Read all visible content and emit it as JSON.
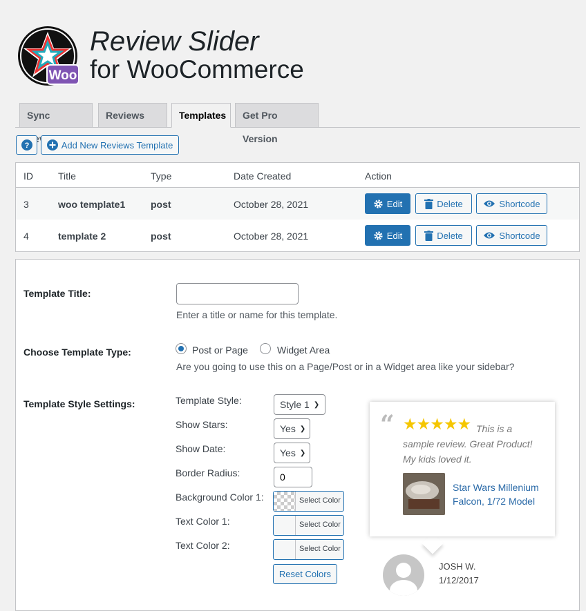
{
  "header": {
    "title_line1": "Review Slider",
    "title_line2": "for WooCommerce",
    "logo_badge": "Woo"
  },
  "tabs": [
    {
      "label": "Sync Reviews",
      "active": false
    },
    {
      "label": "Reviews List",
      "active": false
    },
    {
      "label": "Templates",
      "active": true
    },
    {
      "label": "Get Pro Version",
      "active": false
    }
  ],
  "toolbar": {
    "help_label": "?",
    "add_label": "Add New Reviews Template"
  },
  "table": {
    "headers": [
      "ID",
      "Title",
      "Type",
      "Date Created",
      "Action"
    ],
    "rows": [
      {
        "id": "3",
        "title": "woo template1",
        "type": "post",
        "date": "October 28, 2021"
      },
      {
        "id": "4",
        "title": "template 2",
        "type": "post",
        "date": "October 28, 2021"
      }
    ],
    "actions": {
      "edit": "Edit",
      "delete": "Delete",
      "shortcode": "Shortcode"
    }
  },
  "form": {
    "title_label": "Template Title:",
    "title_value": "",
    "title_hint": "Enter a title or name for this template.",
    "type_label": "Choose Template Type:",
    "type_options": [
      "Post or Page",
      "Widget Area"
    ],
    "type_selected": "Post or Page",
    "type_hint": "Are you going to use this on a Page/Post or in a Widget area like your sidebar?",
    "style_label": "Template Style Settings:",
    "fields": {
      "template_style": {
        "label": "Template Style:",
        "value": "Style 1"
      },
      "show_stars": {
        "label": "Show Stars:",
        "value": "Yes"
      },
      "show_date": {
        "label": "Show Date:",
        "value": "Yes"
      },
      "border_radius": {
        "label": "Border Radius:",
        "value": "0"
      },
      "bg_color": {
        "label": "Background Color 1:",
        "button": "Select Color"
      },
      "text_color1": {
        "label": "Text Color 1:",
        "button": "Select Color"
      },
      "text_color2": {
        "label": "Text Color 2:",
        "button": "Select Color"
      }
    },
    "reset_label": "Reset Colors"
  },
  "preview": {
    "stars": "★★★★★",
    "review": "This is a sample review. Great Product! My kids loved it.",
    "product": "Star Wars Millenium Falcon, 1/72 Model",
    "author": "JOSH W.",
    "date": "1/12/2017"
  },
  "colors": {
    "accent": "#2271b1",
    "star": "#f5c600",
    "link": "#2a6aa8"
  }
}
